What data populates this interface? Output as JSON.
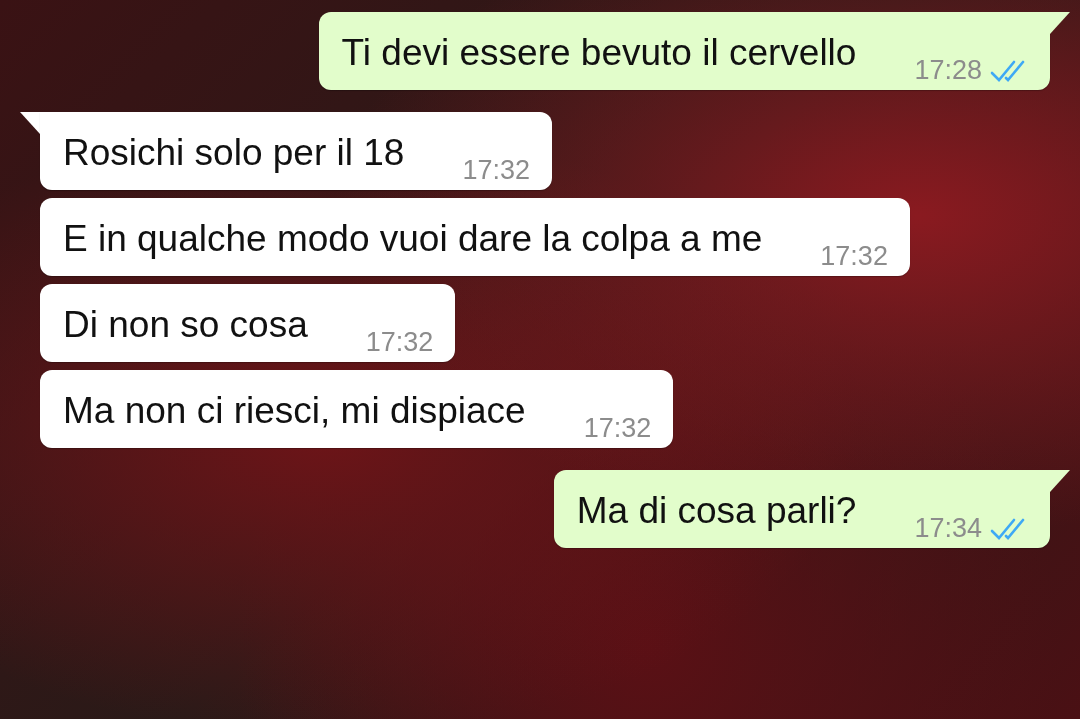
{
  "messages": [
    {
      "kind": "outgoing",
      "text": "Ti devi essere bevuto il cervello",
      "time": "17:28",
      "read": true,
      "tail": true
    },
    {
      "kind": "incoming",
      "text": "Rosichi solo per il 18",
      "time": "17:32",
      "tail": true
    },
    {
      "kind": "incoming",
      "text": "E in qualche modo vuoi dare la colpa a me",
      "time": "17:32",
      "tail": false
    },
    {
      "kind": "incoming",
      "text": "Di non so cosa",
      "time": "17:32",
      "tail": false
    },
    {
      "kind": "incoming",
      "text": "Ma non ci riesci, mi dispiace",
      "time": "17:32",
      "tail": false
    },
    {
      "kind": "outgoing",
      "text": "Ma di cosa parli?",
      "time": "17:34",
      "read": true,
      "tail": true
    }
  ]
}
